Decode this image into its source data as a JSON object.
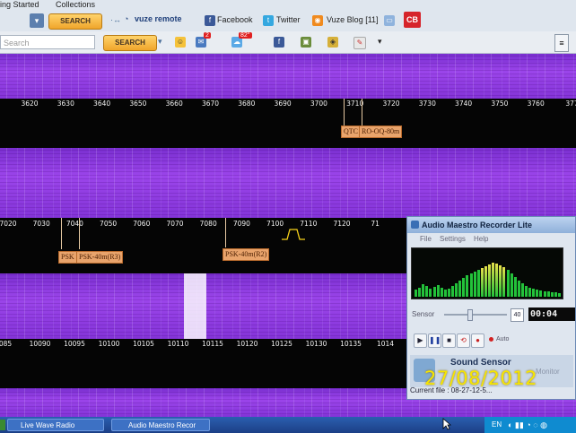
{
  "browser": {
    "bookmarks": [
      "ing Started",
      "Collections"
    ],
    "toolbar": {
      "search_button": "SEARCH",
      "vuze_label": "vuze remote",
      "facebook_label": "Facebook",
      "twitter_label": "Twitter",
      "vuze_blog_label": "Vuze Blog [11]",
      "cb_label": "CB"
    },
    "search_bar": {
      "placeholder": "Search",
      "search_button": "SEARCH",
      "mail_badge": "2",
      "weather_temp": "82°"
    }
  },
  "spectrum": {
    "band1": {
      "ticks": [
        "3620",
        "3630",
        "3640",
        "3650",
        "3660",
        "3670",
        "3680",
        "3690",
        "3700",
        "3710",
        "3720",
        "3730",
        "3740",
        "3750",
        "3760",
        "377"
      ],
      "labels": [
        "QTC",
        "RO-OQ-80m"
      ]
    },
    "band2": {
      "ticks": [
        "7020",
        "7030",
        "7040",
        "7050",
        "7060",
        "7070",
        "7080",
        "7090",
        "7100",
        "7110",
        "7120",
        "71"
      ],
      "labels": [
        "PSK",
        "PSK-40m(R3)",
        "PSK-40m(R2)"
      ]
    },
    "band3": {
      "ticks": [
        "085",
        "10090",
        "10095",
        "10100",
        "10105",
        "10110",
        "10115",
        "10120",
        "10125",
        "10130",
        "10135",
        "1014"
      ]
    }
  },
  "recorder": {
    "title": "Audio Maestro Recorder Lite",
    "menu": [
      "File",
      "Settings",
      "Help"
    ],
    "sensor_label": "Sensor",
    "sensor_value": "40",
    "timer": "00:04",
    "auto_label": "Auto",
    "sound_sensor": "Sound Sensor",
    "monitor": "Monitor",
    "current_file": "Current file : 08-27-12-5..."
  },
  "overlay_date": "27/08/2012",
  "taskbar": {
    "items": [
      "Live Wave Radio",
      "Audio Maestro Recor"
    ],
    "lang": "EN"
  },
  "colors": {
    "waterfall": "#8a3be0",
    "label_bg": "#e9a46c",
    "date_text": "#f7e600",
    "vu_green": "#23c23a"
  }
}
